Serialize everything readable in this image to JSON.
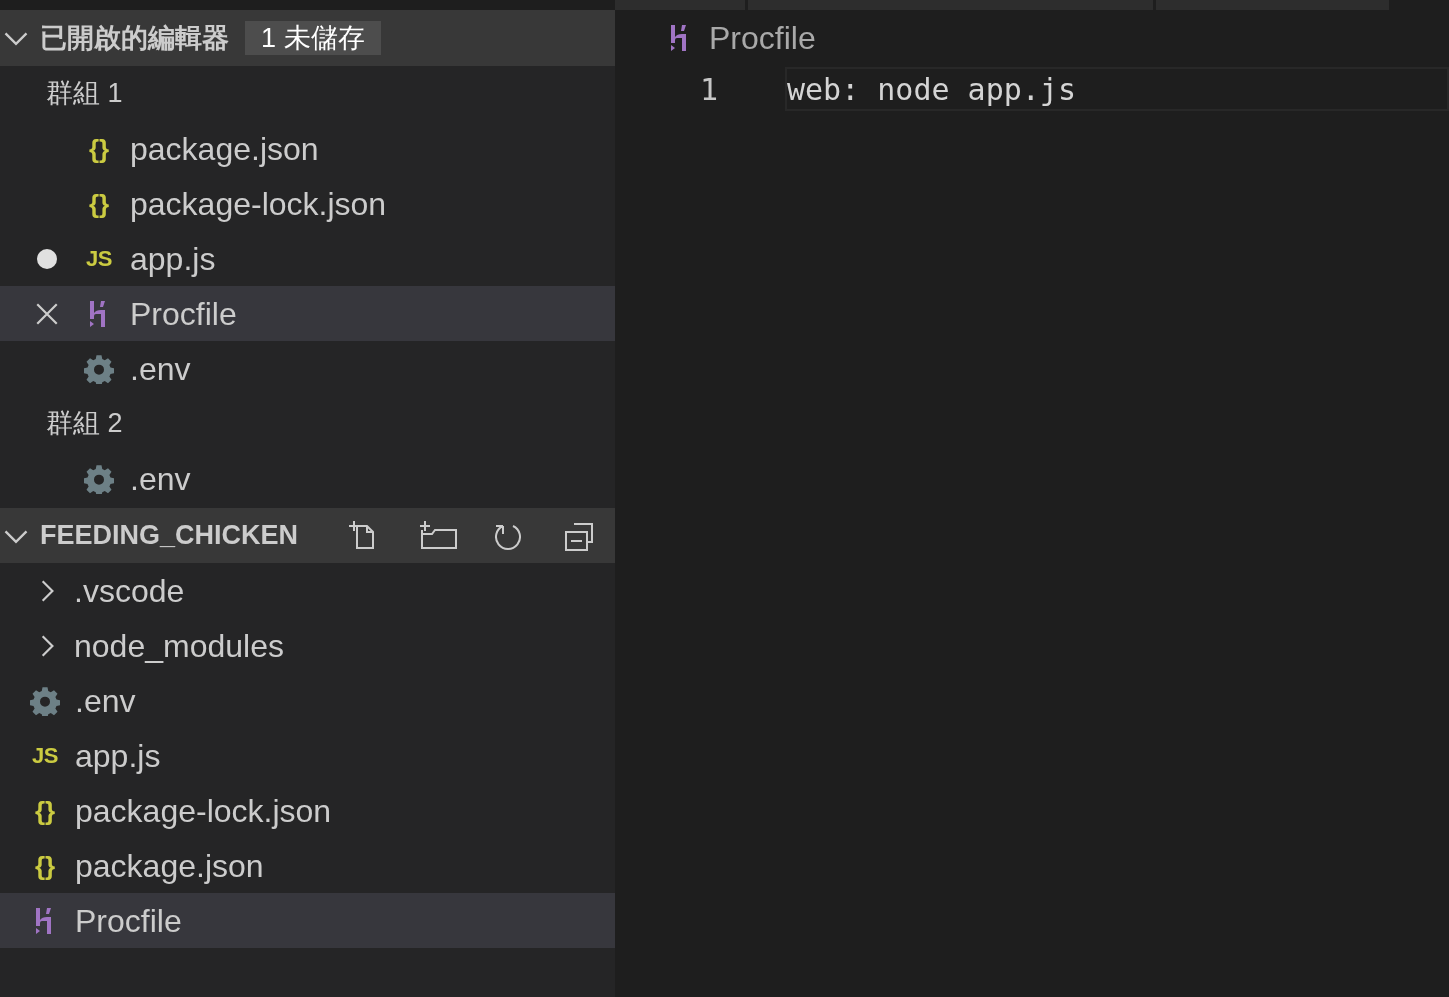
{
  "open_editors": {
    "title": "已開啟的編輯器",
    "badge": "1 未儲存",
    "expanded": true,
    "groups": [
      {
        "label": "群組 1",
        "files": [
          {
            "name": "package.json",
            "kind": "json",
            "icon_text": "{}",
            "modified": false,
            "selected": false
          },
          {
            "name": "package-lock.json",
            "kind": "json",
            "icon_text": "{}",
            "modified": false,
            "selected": false
          },
          {
            "name": "app.js",
            "kind": "js",
            "icon_text": "JS",
            "modified": true,
            "selected": false
          },
          {
            "name": "Procfile",
            "kind": "procfile",
            "modified": false,
            "selected": true
          },
          {
            "name": ".env",
            "kind": "env",
            "modified": false,
            "selected": false
          }
        ]
      },
      {
        "label": "群組 2",
        "files": [
          {
            "name": ".env",
            "kind": "env",
            "modified": false,
            "selected": false
          }
        ]
      }
    ]
  },
  "explorer": {
    "title": "FEEDING_CHICKEN",
    "expanded": true,
    "items": [
      {
        "name": ".vscode",
        "kind": "folder",
        "expanded": false,
        "selected": false
      },
      {
        "name": "node_modules",
        "kind": "folder",
        "expanded": false,
        "selected": false
      },
      {
        "name": ".env",
        "kind": "env",
        "selected": false
      },
      {
        "name": "app.js",
        "kind": "js",
        "icon_text": "JS",
        "selected": false
      },
      {
        "name": "package-lock.json",
        "kind": "json",
        "icon_text": "{}",
        "selected": false
      },
      {
        "name": "package.json",
        "kind": "json",
        "icon_text": "{}",
        "selected": false
      },
      {
        "name": "Procfile",
        "kind": "procfile",
        "selected": true
      }
    ]
  },
  "editor": {
    "breadcrumb": {
      "name": "Procfile",
      "kind": "procfile"
    },
    "lines": [
      {
        "number": "1",
        "text": "web: node app.js"
      }
    ]
  }
}
